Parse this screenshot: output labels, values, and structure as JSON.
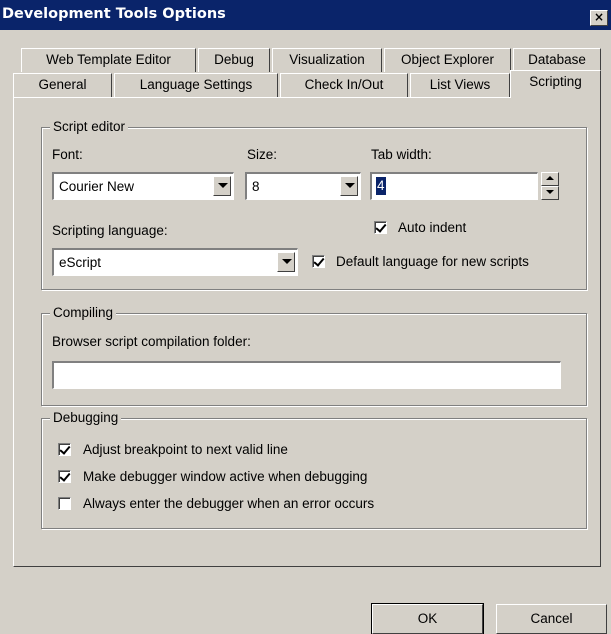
{
  "window": {
    "title": "Development Tools Options",
    "close_label": "×"
  },
  "tabs": {
    "row_back": [
      "Web Template Editor",
      "Debug",
      "Visualization",
      "Object Explorer",
      "Database"
    ],
    "row_front": [
      "General",
      "Language Settings",
      "Check In/Out",
      "List Views",
      "Scripting"
    ],
    "active": "Scripting"
  },
  "script_editor": {
    "legend": "Script editor",
    "font_label": "Font:",
    "font_value": "Courier New",
    "size_label": "Size:",
    "size_value": "8",
    "tab_width_label": "Tab width:",
    "tab_width_value": "4",
    "auto_indent_label": "Auto indent",
    "auto_indent_checked": true,
    "scripting_language_label": "Scripting language:",
    "scripting_language_value": "eScript",
    "default_language_label": "Default language for new scripts",
    "default_language_checked": true
  },
  "compiling": {
    "legend": "Compiling",
    "folder_label": "Browser script compilation folder:",
    "folder_value": ""
  },
  "debugging": {
    "legend": "Debugging",
    "options": [
      {
        "label": "Adjust breakpoint to next valid line",
        "checked": true
      },
      {
        "label": "Make debugger window active when debugging",
        "checked": true
      },
      {
        "label": "Always enter the debugger when an error occurs",
        "checked": false
      }
    ]
  },
  "buttons": {
    "ok": "OK",
    "cancel": "Cancel"
  },
  "colors": {
    "titlebar": "#0a246a",
    "face": "#d4d0c8",
    "selection": "#0a246a"
  }
}
